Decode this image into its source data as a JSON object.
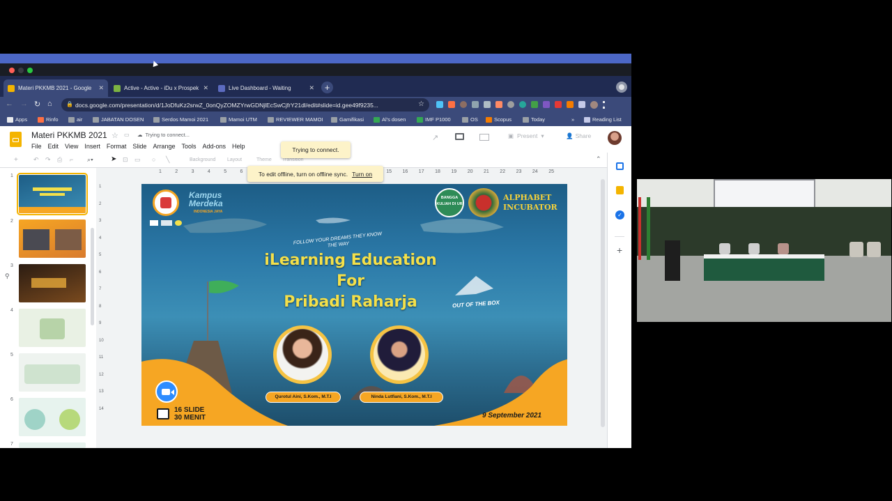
{
  "browser": {
    "tabs": [
      {
        "label": "Materi PKKMB 2021 - Google",
        "color": "#f4b400"
      },
      {
        "label": "Active - Active - iDu x Prospek",
        "color": "#7cb342"
      },
      {
        "label": "Live Dashboard - Waiting",
        "color": "#5c6bc0"
      }
    ],
    "close_glyph": "✕",
    "new_tab_glyph": "+",
    "url": "docs.google.com/presentation/d/1JoDfuKz2srwZ_0onQyZOMZYrwGDNjlEcSwCjfrY21dl/edit#slide=id.gee49f9235...",
    "bookmarks": [
      "Apps",
      "Rinfo",
      "air",
      "JABATAN DOSEN",
      "Serdos Mamoi 2021",
      "Mamoi UTM",
      "REVIEWER MAMOI",
      "Gamifikasi",
      "Al's dosen",
      "IMF P1000",
      "OS",
      "Scopus",
      "Today"
    ],
    "bookmarks_more": "»",
    "reading_list": "Reading List"
  },
  "docs": {
    "title": "Materi PKKMB 2021",
    "status": "Trying to connect...",
    "menus": [
      "File",
      "Edit",
      "View",
      "Insert",
      "Format",
      "Slide",
      "Arrange",
      "Tools",
      "Add-ons",
      "Help"
    ],
    "present_label": "Present",
    "share_label": "Share",
    "toolbar_items": [
      "Background",
      "Layout",
      "Theme",
      "Transition"
    ],
    "ruler_h": [
      "1",
      "2",
      "3",
      "4",
      "5",
      "6",
      "7",
      "8",
      "9",
      "10",
      "11",
      "12",
      "13",
      "14",
      "15",
      "16",
      "17",
      "18",
      "19",
      "20",
      "21",
      "22",
      "23",
      "24",
      "25"
    ],
    "ruler_v": [
      "1",
      "2",
      "3",
      "4",
      "5",
      "6",
      "7",
      "8",
      "9",
      "10",
      "11",
      "12",
      "13",
      "14"
    ],
    "thumbnail_numbers": [
      "1",
      "2",
      "3",
      "4",
      "5",
      "6",
      "7"
    ],
    "popup_connect": "Trying to connect.",
    "popup_offline": "To edit offline, turn on offline sync.",
    "popup_turn_on": "Turn on"
  },
  "slide": {
    "logo_left": "Kampus Merdeka",
    "logo_left_sub": "INDONESIA JAYA",
    "logo_right_badge": "BANGGA KULIAH DI UR",
    "logo_right": "ALPHABET INCUBATOR",
    "tagline": "FOLLOW YOUR DREAMS THEY KNOW THE WAY",
    "title_line1": "iLearning Education",
    "title_line2": "For",
    "title_line3": "Pribadi Raharja",
    "side_note": "OUT OF THE BOX",
    "speaker1": "Qurotul Aini, S.Kom., M.T.I",
    "speaker2": "Ninda Lutfiani, S.Kom., M.T.I",
    "slide_count": "16 SLIDE",
    "duration": "30 MENIT",
    "date": "9 September 2021"
  }
}
